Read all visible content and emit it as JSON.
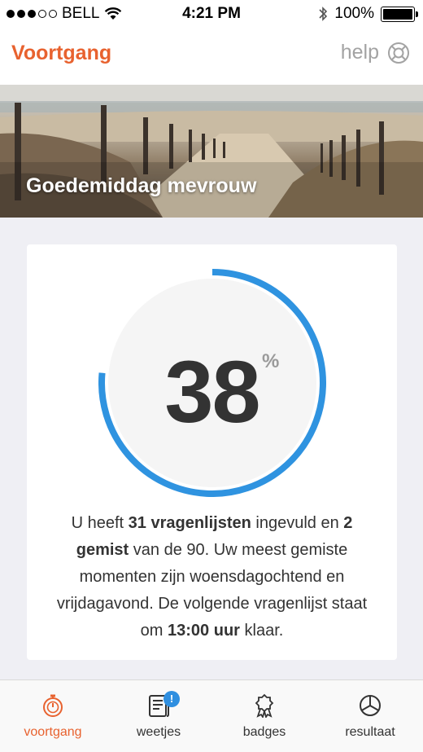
{
  "status_bar": {
    "carrier": "BELL",
    "time": "4:21 PM",
    "battery": "100%"
  },
  "nav": {
    "title": "Voortgang",
    "help_label": "help"
  },
  "hero": {
    "greeting": "Goedemiddag mevrouw"
  },
  "progress": {
    "value": "38",
    "unit": "%",
    "fraction": 0.38,
    "ring_color": "#2f93e0",
    "summary": {
      "p1": "U heeft ",
      "b1": "31 vragenlijsten",
      "p2": " ingevuld en ",
      "b2": "2 gemist",
      "p3": " van de 90. Uw meest gemiste momenten zijn woensdagochtend en vrijdagavond. De volgende vragenlijst staat om ",
      "b3": "13:00 uur",
      "p4": " klaar."
    }
  },
  "tabs": [
    {
      "label": "voortgang",
      "icon": "stopwatch-icon",
      "active": true
    },
    {
      "label": "weetjes",
      "icon": "newspaper-icon",
      "badge": "!"
    },
    {
      "label": "badges",
      "icon": "ribbon-badge-icon"
    },
    {
      "label": "resultaat",
      "icon": "pie-chart-icon"
    }
  ],
  "colors": {
    "accent": "#e8622f",
    "ring": "#2f93e0",
    "badge": "#2f8fe0"
  }
}
